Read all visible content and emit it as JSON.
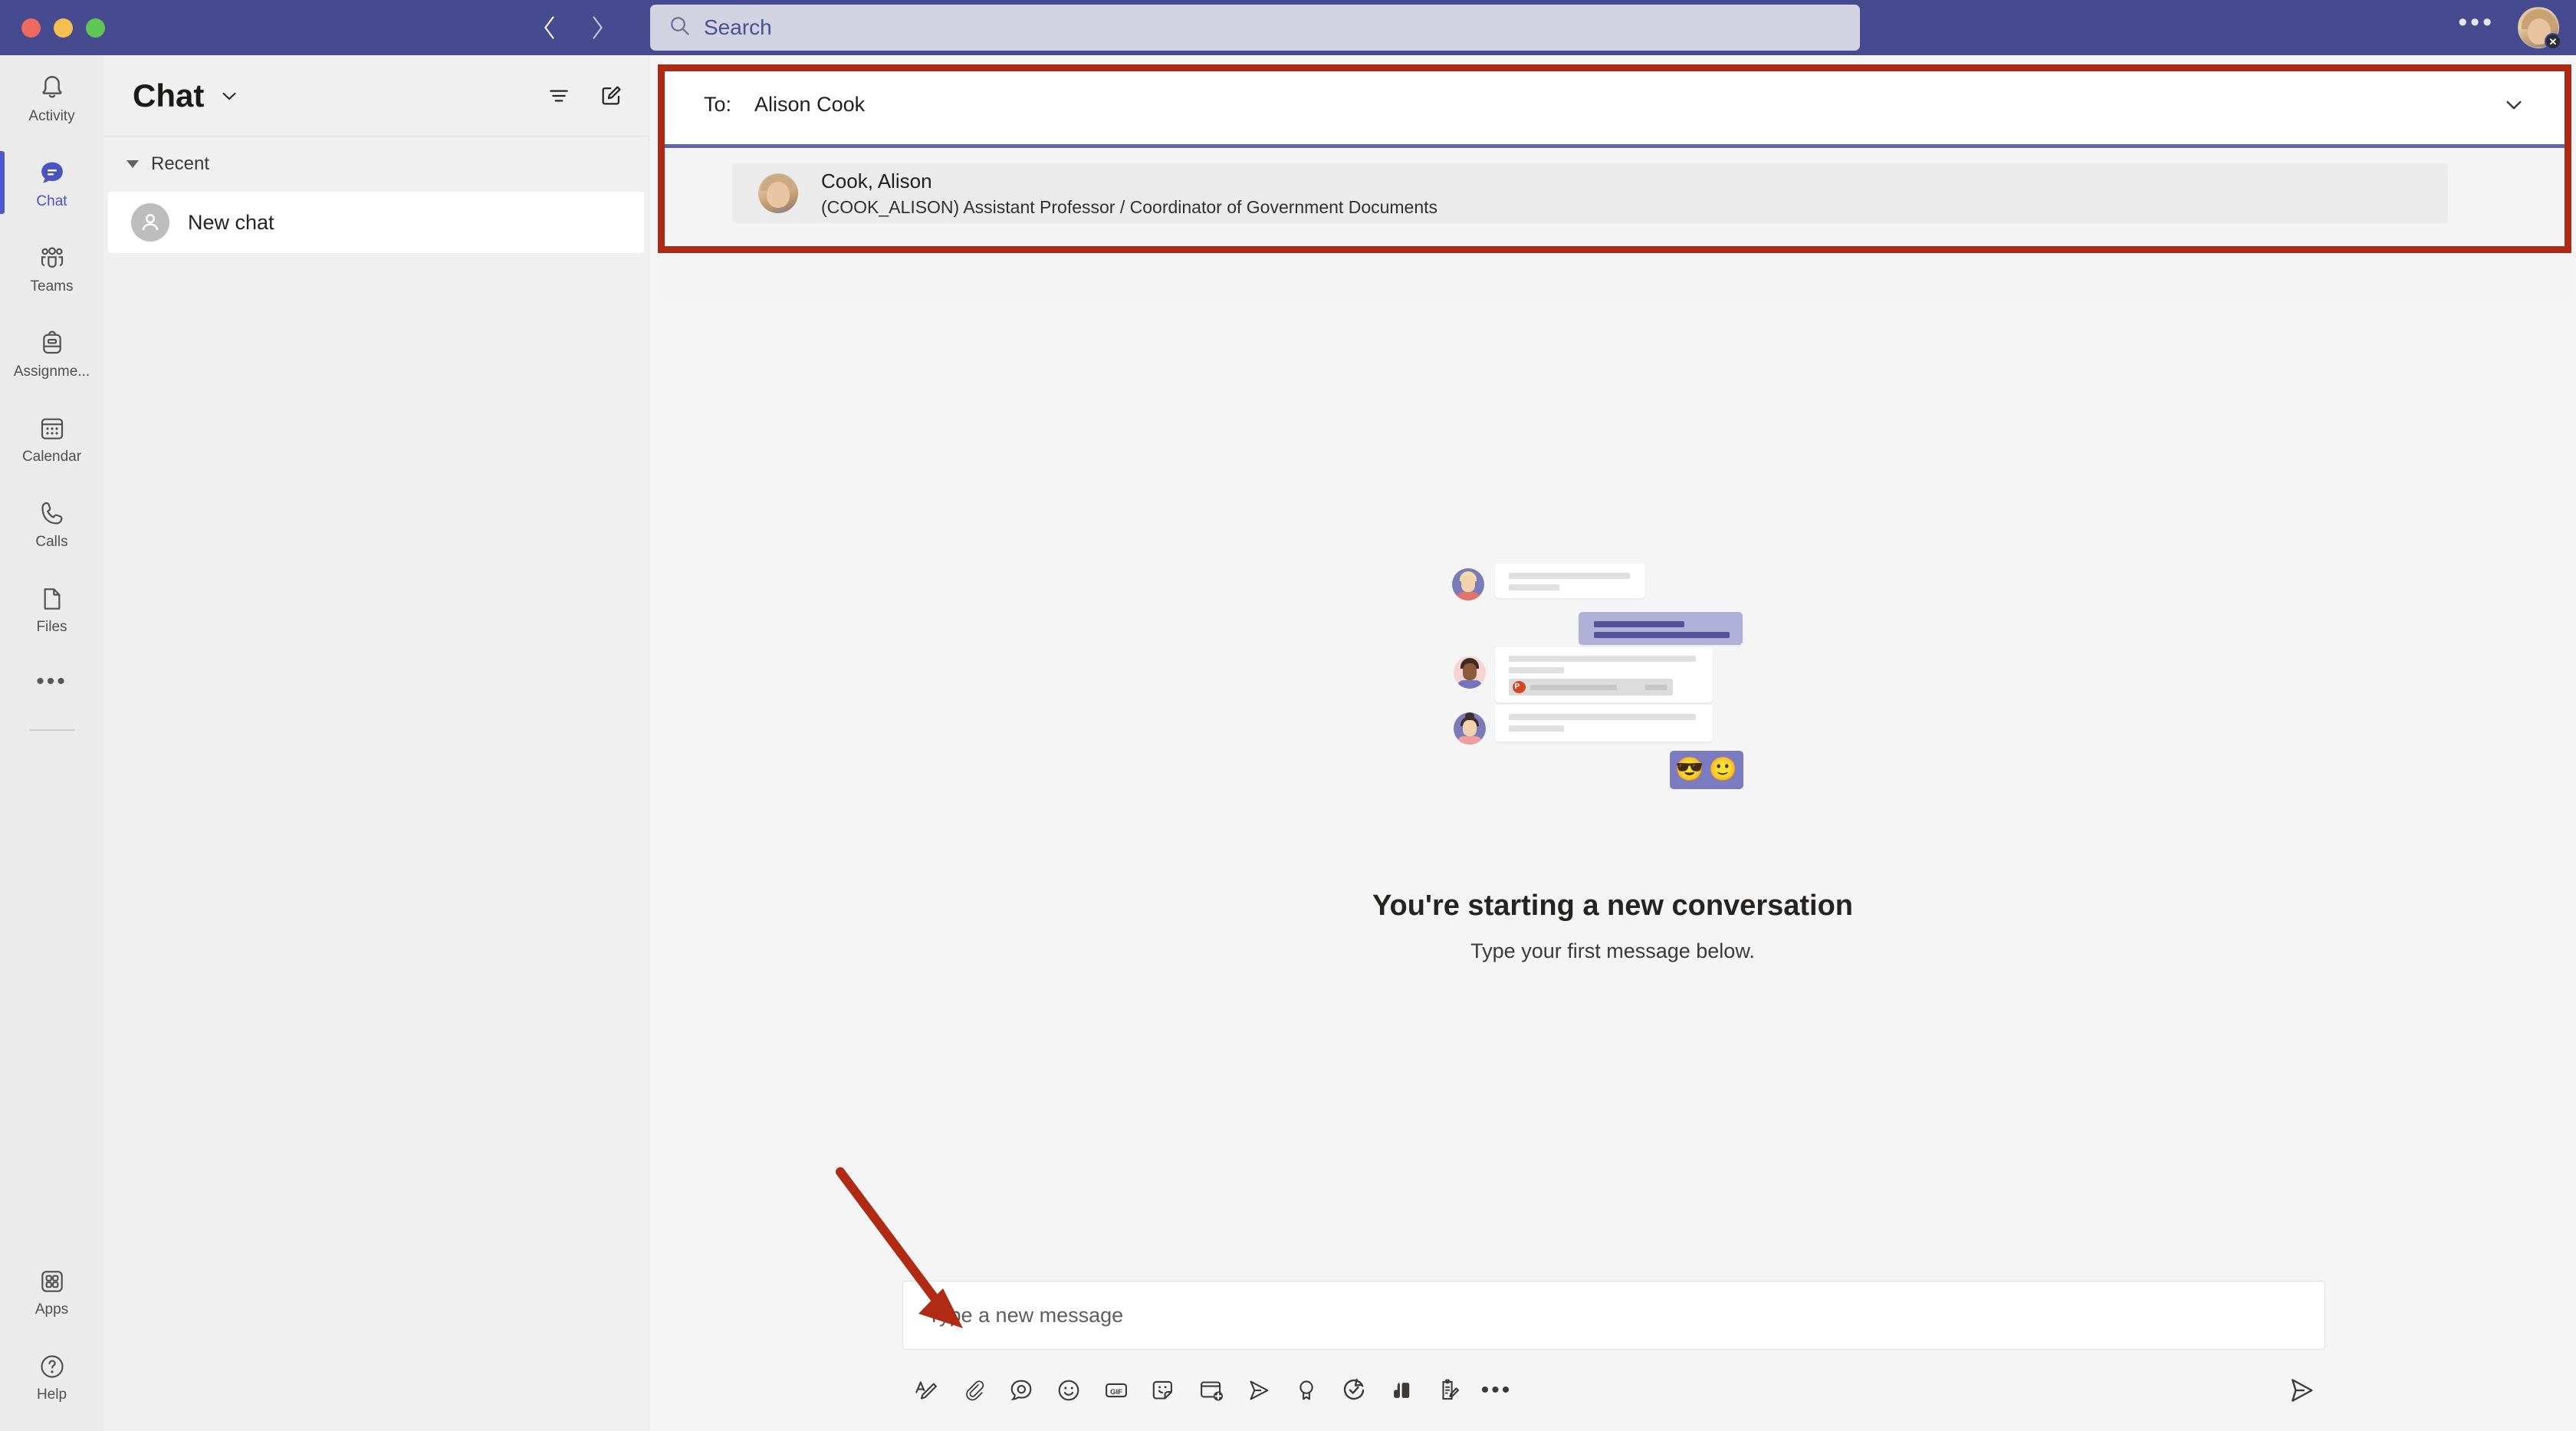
{
  "window": {
    "traffic_lights": [
      "close",
      "minimize",
      "zoom"
    ],
    "colors": {
      "header_purple": "#464a8f",
      "accent": "#6264a7",
      "annotation_red": "#ab2a16",
      "active_blue": "#4b53bc"
    }
  },
  "topbar": {
    "back_icon": "chevron-left-icon",
    "forward_icon": "chevron-right-icon",
    "search": {
      "icon": "search-icon",
      "placeholder": "Search",
      "value": ""
    },
    "more_icon": "ellipsis-icon",
    "avatar": {
      "name": "avatar",
      "status": "do-not-disturb"
    }
  },
  "rail": {
    "items": [
      {
        "label": "Activity",
        "icon": "bell-icon",
        "active": false
      },
      {
        "label": "Chat",
        "icon": "chat-icon",
        "active": true
      },
      {
        "label": "Teams",
        "icon": "people-icon",
        "active": false
      },
      {
        "label": "Assignme...",
        "icon": "backpack-icon",
        "active": false
      },
      {
        "label": "Calendar",
        "icon": "calendar-icon",
        "active": false
      },
      {
        "label": "Calls",
        "icon": "phone-icon",
        "active": false
      },
      {
        "label": "Files",
        "icon": "file-icon",
        "active": false
      }
    ],
    "more_icon": "ellipsis-icon",
    "bottom": [
      {
        "label": "Apps",
        "icon": "grid-apps-icon"
      },
      {
        "label": "Help",
        "icon": "question-circle-icon"
      }
    ]
  },
  "chat_panel": {
    "title": "Chat",
    "title_chevron_icon": "chevron-down-icon",
    "filter_icon": "filter-icon",
    "compose_icon": "new-chat-icon",
    "section": {
      "label": "Recent",
      "expanded": true
    },
    "items": [
      {
        "label": "New chat",
        "avatar_icon": "person-icon",
        "selected": true
      }
    ]
  },
  "main": {
    "to_field": {
      "label": "To:",
      "value": "Alison Cook",
      "chevron_icon": "chevron-down-icon"
    },
    "suggestions": [
      {
        "name": "Cook, Alison",
        "detail": "(COOK_ALISON) Assistant Professor / Coordinator of Government Documents",
        "avatar": "person-photo"
      }
    ],
    "empty_state": {
      "title": "You're starting a new conversation",
      "subtitle": "Type your first message below.",
      "illustration": "chat-bubbles-illustration",
      "emojis": [
        "😎",
        "🙂"
      ]
    },
    "compose": {
      "placeholder": "Type a new message",
      "value": "",
      "toolbar": [
        {
          "icon": "format-text-icon",
          "name": "format"
        },
        {
          "icon": "attach-paperclip-icon",
          "name": "attach"
        },
        {
          "icon": "loop-icon",
          "name": "loop-component"
        },
        {
          "icon": "emoji-smiley-icon",
          "name": "emoji"
        },
        {
          "icon": "gif-icon",
          "name": "giphy",
          "text": "GIF"
        },
        {
          "icon": "sticker-icon",
          "name": "sticker"
        },
        {
          "icon": "meet-now-icon",
          "name": "schedule-meeting"
        },
        {
          "icon": "stream-icon",
          "name": "stream"
        },
        {
          "icon": "praise-badge-icon",
          "name": "praise"
        },
        {
          "icon": "approvals-icon",
          "name": "approvals"
        },
        {
          "icon": "polls-icon",
          "name": "polls"
        },
        {
          "icon": "forms-icon",
          "name": "forms"
        },
        {
          "icon": "ellipsis-icon",
          "name": "more-options"
        }
      ],
      "send_icon": "send-icon"
    }
  },
  "annotations": {
    "rectangle": {
      "color": "#ab2a16",
      "target": "to-field-and-suggestions"
    },
    "arrow": {
      "color": "#b02b13",
      "target": "message-compose-box"
    }
  }
}
